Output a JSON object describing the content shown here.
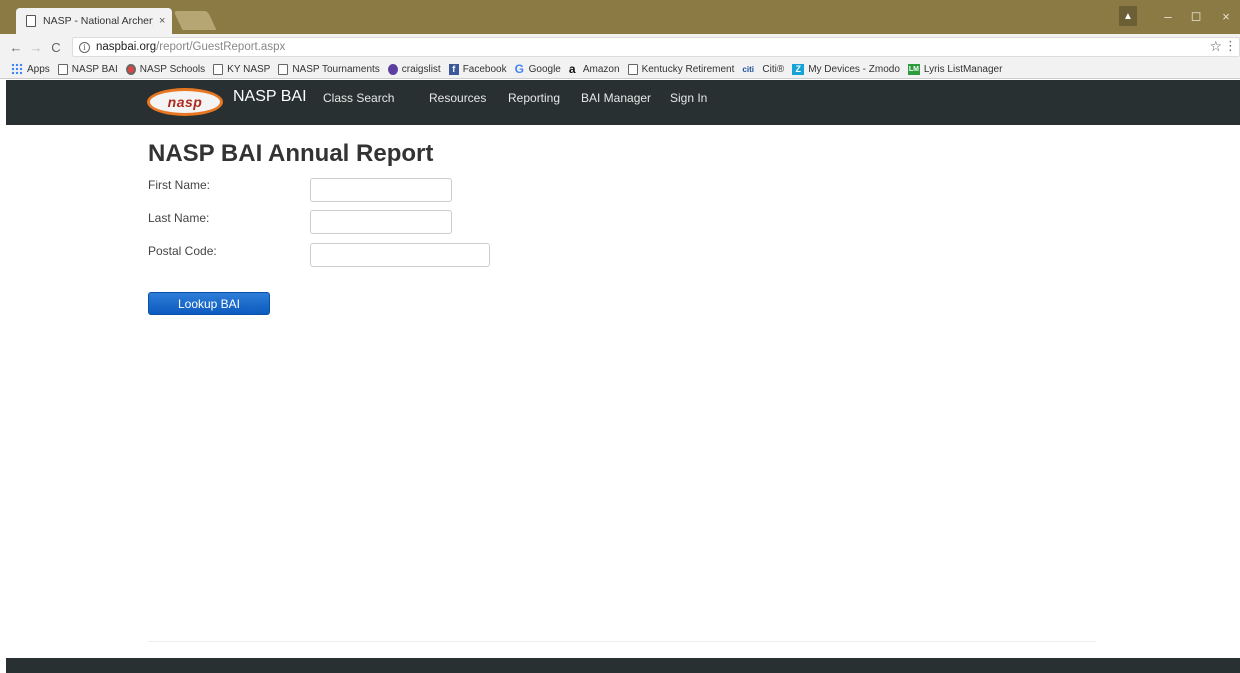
{
  "browser": {
    "tab_title": "NASP - National Archery",
    "tab_close": "×",
    "url_host": "naspbai.org",
    "url_path": "/report/GuestReport.aspx",
    "window_controls": {
      "minimize": "–",
      "maximize": "◻",
      "close": "×"
    },
    "profile_icon": "▲"
  },
  "bookmarks": [
    {
      "label": "Apps",
      "icon": "apps-icon"
    },
    {
      "label": "NASP BAI",
      "icon": "page-icon"
    },
    {
      "label": "NASP Schools",
      "icon": "target-icon"
    },
    {
      "label": "KY NASP",
      "icon": "page-icon"
    },
    {
      "label": "NASP Tournaments",
      "icon": "page-icon"
    },
    {
      "label": "craigslist",
      "icon": "peace-icon"
    },
    {
      "label": "Facebook",
      "icon": "facebook-icon"
    },
    {
      "label": "Google",
      "icon": "google-icon"
    },
    {
      "label": "Amazon",
      "icon": "amazon-icon"
    },
    {
      "label": "Kentucky Retirement",
      "icon": "page-icon"
    },
    {
      "label": "Citi®",
      "icon": "citi-icon"
    },
    {
      "label": "My Devices - Zmodo",
      "icon": "zmodo-icon"
    },
    {
      "label": "Lyris ListManager",
      "icon": "lyris-icon"
    }
  ],
  "site": {
    "logo_text": "nasp",
    "brand": "NASP BAI",
    "nav": [
      "Class Search",
      "Resources",
      "Reporting",
      "BAI Manager",
      "Sign In"
    ]
  },
  "main": {
    "title": "NASP BAI Annual Report",
    "fields": {
      "first_name_label": "First Name:",
      "last_name_label": "Last Name:",
      "postal_code_label": "Postal Code:",
      "first_name_value": "",
      "last_name_value": "",
      "postal_code_value": ""
    },
    "button": "Lookup BAI"
  }
}
